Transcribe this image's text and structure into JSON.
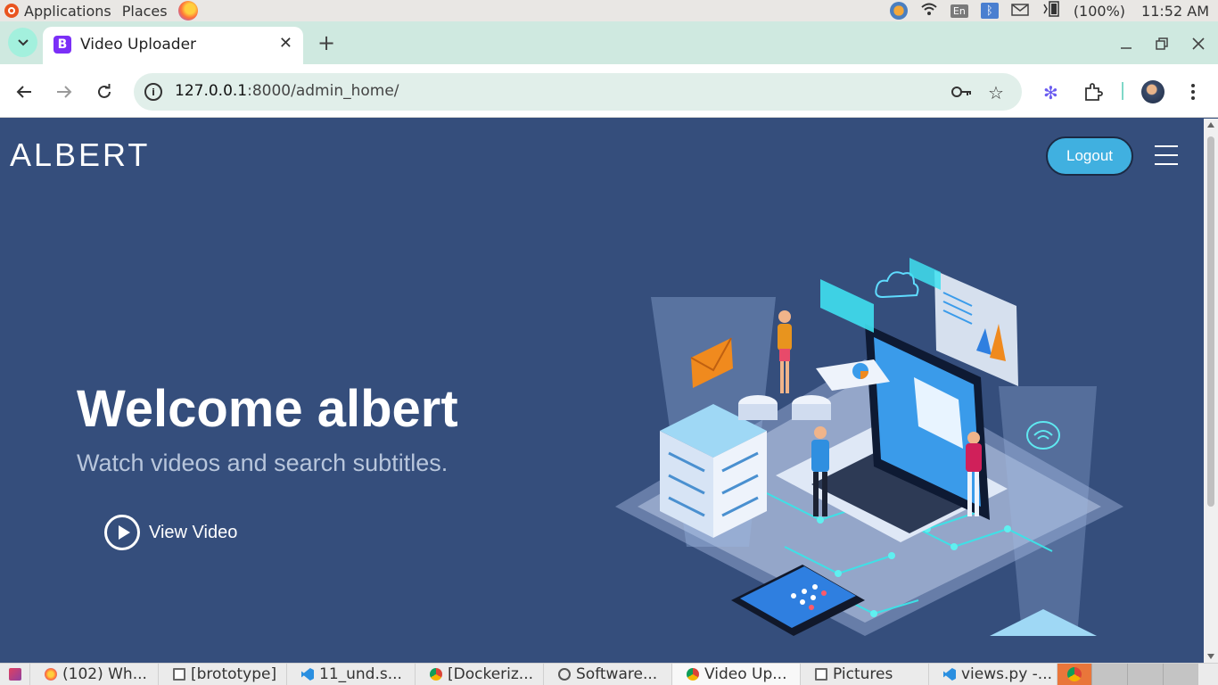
{
  "os_bar": {
    "applications": "Applications",
    "places": "Places",
    "language": "En",
    "battery": "(100%)",
    "clock": "11:52 AM"
  },
  "browser": {
    "tab_title": "Video Uploader",
    "tab_favicon_letter": "B",
    "url_host": "127.0.0.1",
    "url_path": ":8000/admin_home/"
  },
  "site": {
    "brand": "ALBERT",
    "logout_label": "Logout",
    "hero_title": "Welcome albert",
    "hero_subtitle": "Watch videos and search subtitles.",
    "view_video_label": "View Video"
  },
  "taskbar": {
    "items": [
      {
        "label": "(102) Wh..."
      },
      {
        "label": "[brototype]"
      },
      {
        "label": "11_und.s..."
      },
      {
        "label": "[Dockeriz..."
      },
      {
        "label": "Software..."
      },
      {
        "label": "Video Up..."
      },
      {
        "label": "Pictures"
      },
      {
        "label": "views.py -..."
      }
    ]
  },
  "colors": {
    "page_bg": "#354e7c",
    "logout_bg": "#40b0e0",
    "tabstrip_bg": "#cfe9e0"
  }
}
